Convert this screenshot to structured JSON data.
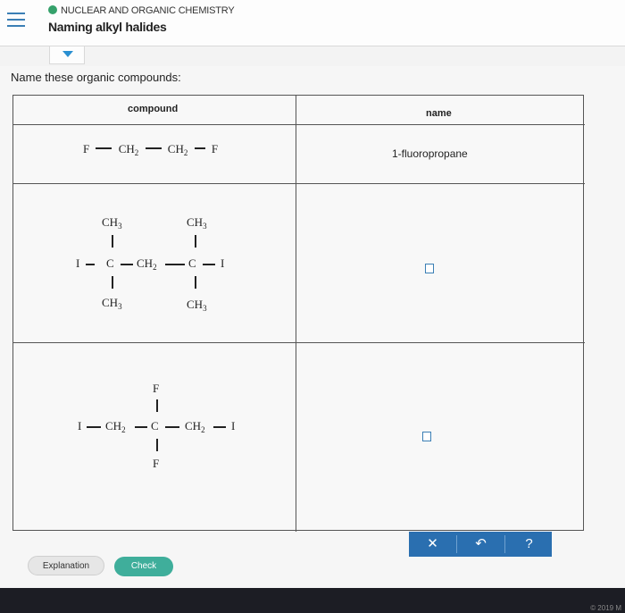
{
  "header": {
    "topic": "NUCLEAR AND ORGANIC CHEMISTRY",
    "title": "Naming alkyl halides"
  },
  "prompt": "Name these organic compounds:",
  "table": {
    "headers": {
      "compound": "compound",
      "name": "name"
    },
    "rows": [
      {
        "compound": {
          "f_left": "F",
          "ch2": "CH",
          "sub2": "2",
          "f_right": "F"
        },
        "answer": "1-fluoropropane"
      },
      {
        "compound": {
          "ch3": "CH",
          "sub3": "3",
          "ch2": "CH",
          "sub2": "2",
          "c": "C",
          "i": "I"
        },
        "answer": ""
      },
      {
        "compound": {
          "f": "F",
          "ch2": "CH",
          "sub2": "2",
          "c": "C",
          "i": "I"
        },
        "answer": ""
      }
    ]
  },
  "toolbar": {
    "clear": "✕",
    "undo": "↶",
    "help": "?"
  },
  "buttons": {
    "explanation": "Explanation",
    "check": "Check"
  },
  "footer": {
    "copyright": "© 2019 M"
  },
  "colors": {
    "accent": "#2a6fb0",
    "check": "#3fae9b",
    "topic_dot": "#35a16b"
  }
}
